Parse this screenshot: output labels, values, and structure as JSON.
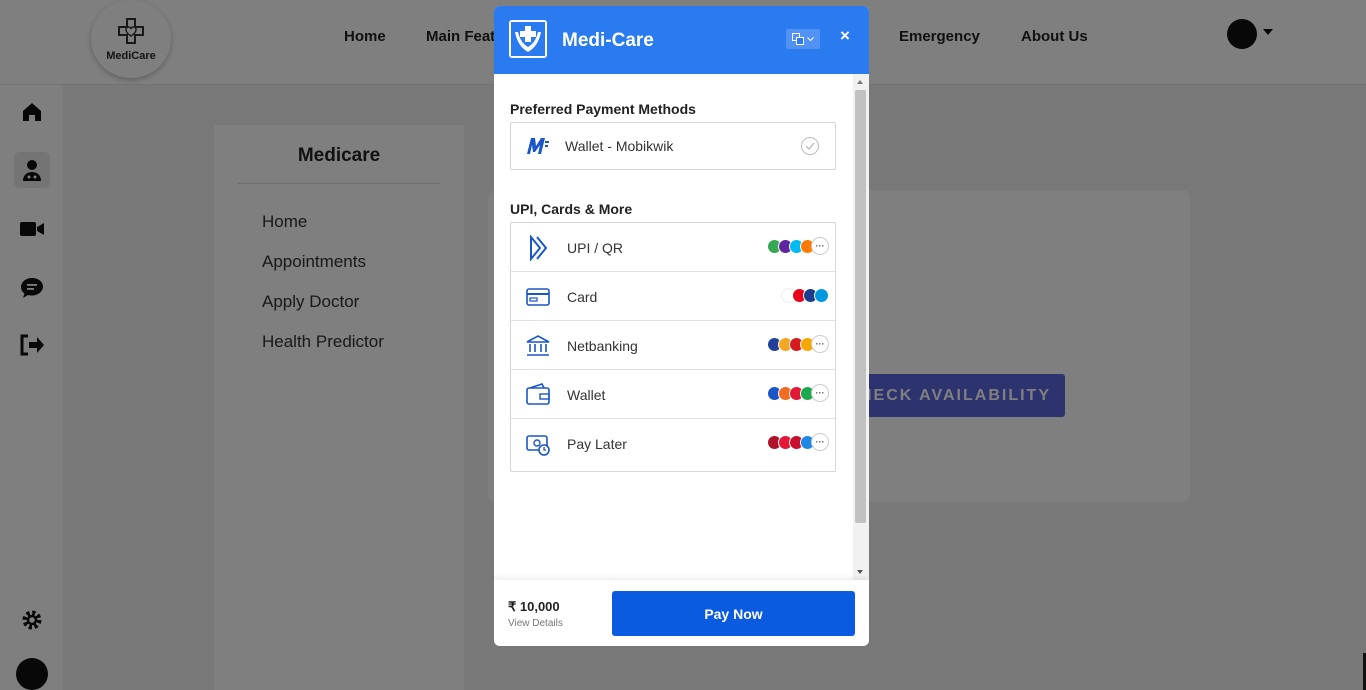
{
  "brand": {
    "logo_text": "MediCare"
  },
  "nav": {
    "links": [
      "Home",
      "Main Features",
      "Emergency",
      "About Us"
    ]
  },
  "sidebar": {
    "title": "Medicare",
    "items": [
      "Home",
      "Appointments",
      "Apply Doctor",
      "Health Predictor"
    ]
  },
  "main": {
    "check_button": "CHECK AVAILABILITY"
  },
  "modal": {
    "title": "Medi-Care",
    "close": "×",
    "preferred_title": "Preferred Payment Methods",
    "preferred_method": "Wallet - Mobikwik",
    "more_title": "UPI, Cards & More",
    "methods": [
      "UPI / QR",
      "Card",
      "Netbanking",
      "Wallet",
      "Pay Later"
    ],
    "amount": "₹ 10,000",
    "view_details": "View Details",
    "pay_button": "Pay Now"
  },
  "colors": {
    "modal_header": "#2b7bf0",
    "pay_button": "#0a5be0",
    "check_button": "#5867dd"
  }
}
